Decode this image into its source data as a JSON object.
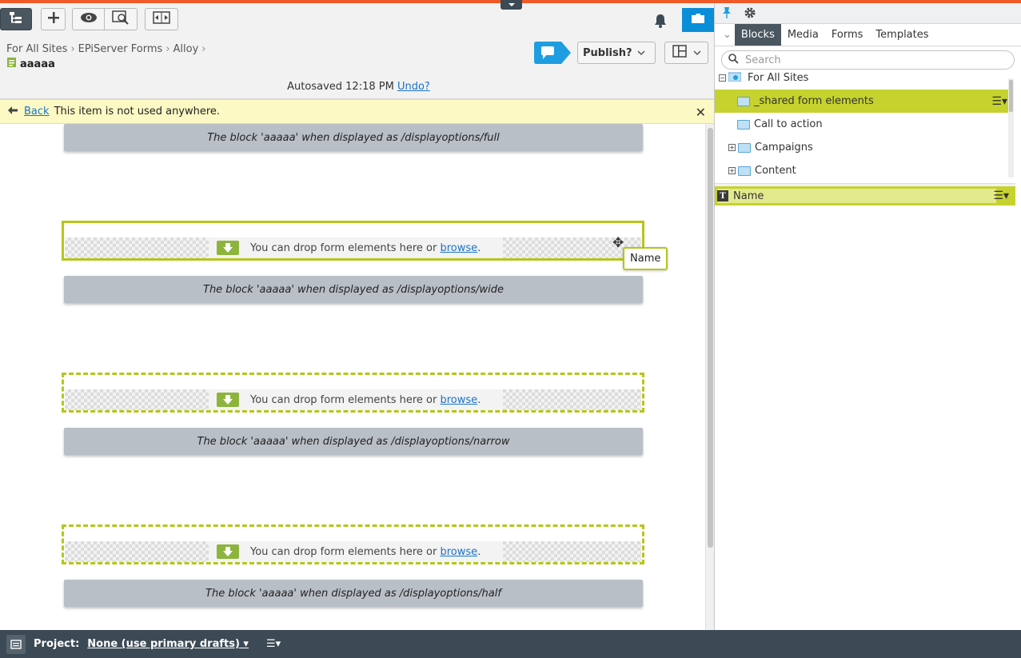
{
  "toolbar": {
    "tree_icon": "page-tree-icon",
    "add_icon": "plus-icon",
    "preview_icon": "eye-icon",
    "view_icon": "preview-magnify-icon",
    "compare_icon": "compare-icon",
    "bell_icon": "bell-icon",
    "assets_icon": "folder-icon"
  },
  "breadcrumb": {
    "items": [
      "For All Sites",
      "EPiServer Forms",
      "Alloy"
    ],
    "page_name": "aaaaa"
  },
  "publish": {
    "label": "Publish?"
  },
  "autosave": {
    "text": "Autosaved 12:18 PM",
    "undo_label": "Undo?"
  },
  "notification": {
    "back_label": "Back",
    "message": "This item is not used anywhere."
  },
  "content": {
    "blocks": [
      "The block 'aaaaa' when displayed as /displayoptions/full",
      "The block 'aaaaa' when displayed as /displayoptions/wide",
      "The block 'aaaaa' when displayed as /displayoptions/narrow",
      "The block 'aaaaa' when displayed as /displayoptions/half"
    ],
    "drop_text": "You can drop form elements here or",
    "drop_link": "browse",
    "drop_suffix": ".",
    "tooltip": "Name"
  },
  "assets_pane": {
    "tabs": [
      "Blocks",
      "Media",
      "Forms",
      "Templates"
    ],
    "active_tab": "Blocks",
    "search_placeholder": "Search",
    "root": "For All Sites",
    "folders": [
      {
        "label": "_shared form elements",
        "selected": true,
        "expandable": false
      },
      {
        "label": "Call to action",
        "selected": false,
        "expandable": false
      },
      {
        "label": "Campaigns",
        "selected": false,
        "expandable": true
      },
      {
        "label": "Content",
        "selected": false,
        "expandable": true
      }
    ],
    "selected_item": "Name"
  },
  "footer": {
    "project_label": "Project:",
    "project_value": "None (use primary drafts)"
  },
  "colors": {
    "accent_orange": "#f05a28",
    "highlight_green": "#c6d22e",
    "dropzone_border": "#b5c619",
    "dark_toolbar": "#3c4a55",
    "link_blue": "#1a73c8",
    "notification_bg": "#fdf9c4"
  }
}
